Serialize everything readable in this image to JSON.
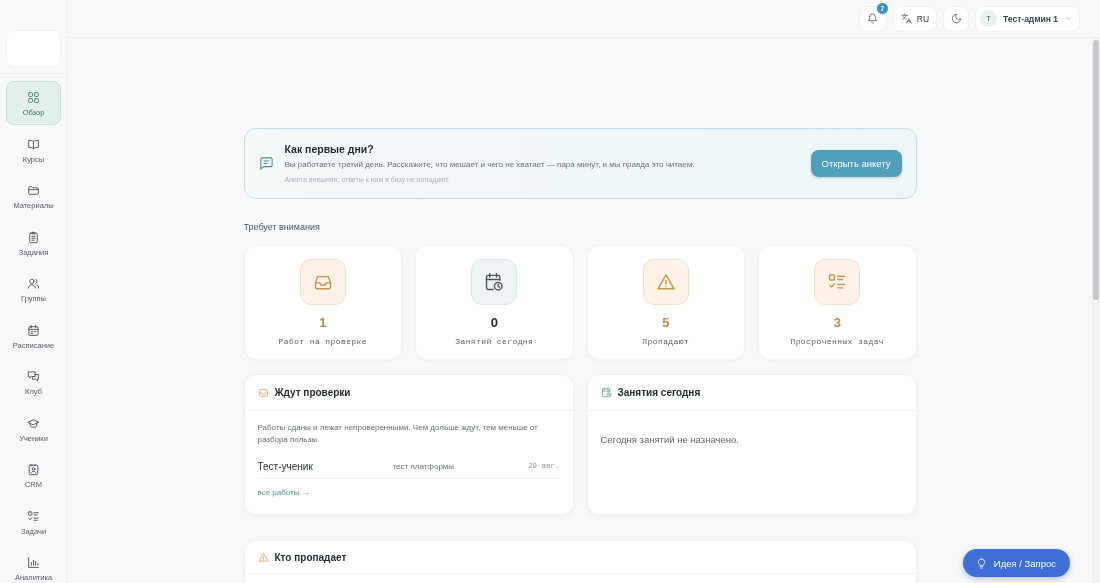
{
  "topbar": {
    "notifications": {
      "badge": "7"
    },
    "language": {
      "label": "RU"
    },
    "user": {
      "avatar": "T",
      "name": "Тест-админ 1"
    }
  },
  "sidebar": {
    "items": [
      {
        "label": "Обзор",
        "selected": true
      },
      {
        "label": "Курсы",
        "selected": false
      },
      {
        "label": "Материалы",
        "selected": false
      },
      {
        "label": "Задания",
        "selected": false
      },
      {
        "label": "Группы",
        "selected": false
      },
      {
        "label": "Расписание",
        "selected": false
      },
      {
        "label": "Клуб",
        "selected": false
      },
      {
        "label": "Ученики",
        "selected": false
      },
      {
        "label": "CRM",
        "selected": false
      },
      {
        "label": "Задачи",
        "selected": false
      },
      {
        "label": "Аналитика",
        "selected": false
      }
    ]
  },
  "banner": {
    "title": "Как первые дни?",
    "text": "Вы работаете третий день. Расскажите, что мешает и чего не хватает — пара минут, и мы правда это читаем.",
    "note": "Анкета внешняя, ответы к нам в базу не попадают.",
    "button": "Открыть анкету"
  },
  "attention": {
    "heading": "Требует внимания",
    "cards": [
      {
        "kind": "alert",
        "value": "1",
        "label": "Работ на проверке"
      },
      {
        "kind": "neutral",
        "value": "0",
        "label": "Занятий сегодня"
      },
      {
        "kind": "alert",
        "value": "5",
        "label": "Пропадают"
      },
      {
        "kind": "alert",
        "value": "3",
        "label": "Просроченных задач"
      }
    ]
  },
  "pending_review": {
    "title": "Ждут проверки",
    "description": "Работы сданы и лежат непроверенными. Чем дольше ждут, тем меньше от разбора пользы.",
    "rows": [
      {
        "student": "Тест-ученик",
        "course": "тест платформы",
        "date": "29 авг."
      }
    ],
    "link": "все работы →"
  },
  "today_lessons": {
    "title": "Занятия сегодня",
    "empty_text": "Сегодня занятий не назначено."
  },
  "missing_students": {
    "title": "Кто пропадает"
  },
  "feedback_button": {
    "label": "Идея / Запрос"
  }
}
